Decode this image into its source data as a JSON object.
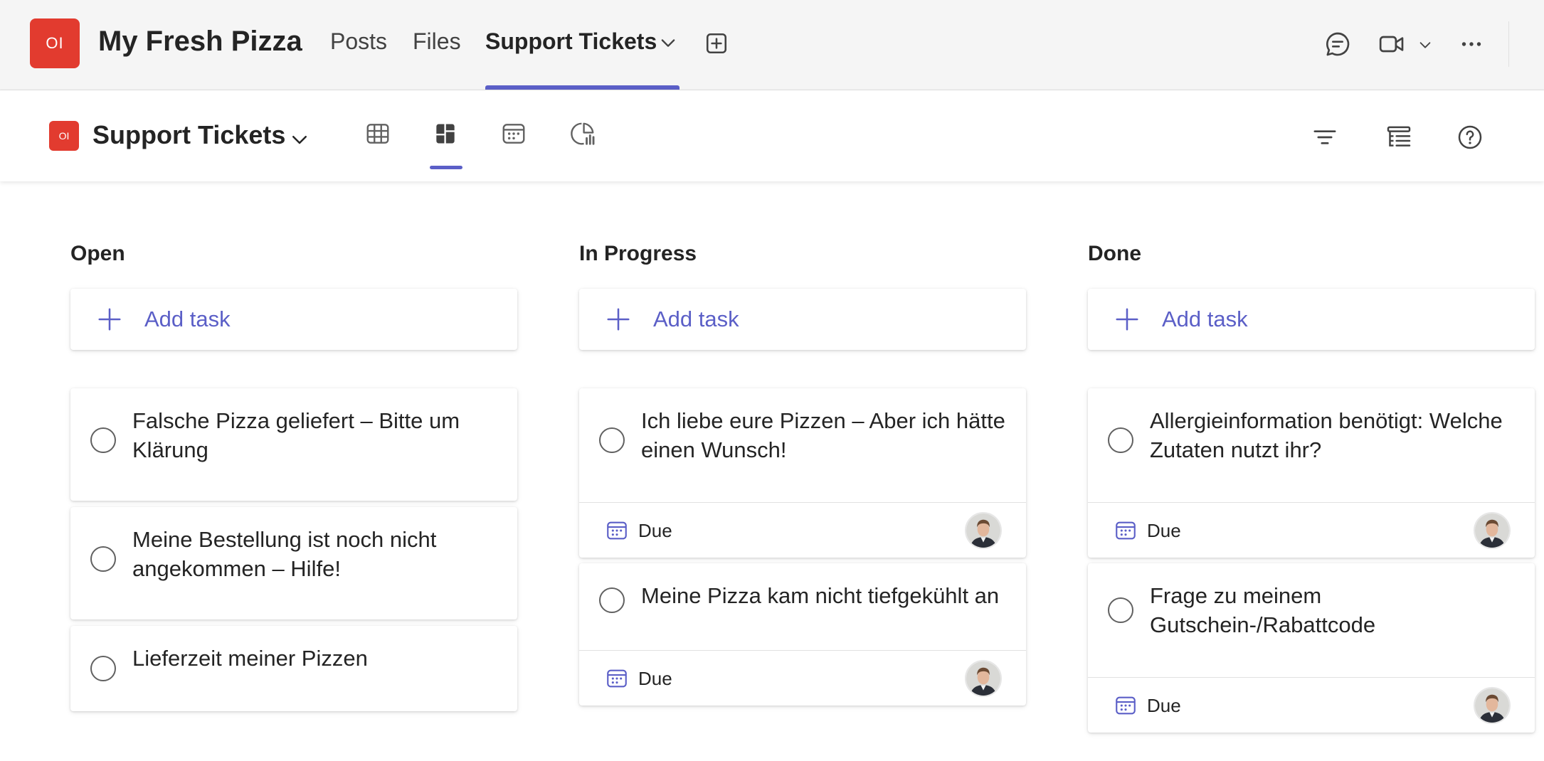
{
  "app": {
    "team_initials": "OI",
    "team_name": "My Fresh Pizza",
    "tabs": [
      {
        "label": "Posts"
      },
      {
        "label": "Files"
      },
      {
        "label": "Support Tickets"
      }
    ],
    "accent": "#5b5fc7",
    "brand_red": "#e23b2f"
  },
  "toolbar": {
    "plan_initials": "OI",
    "plan_name": "Support Tickets",
    "views": [
      "grid-icon",
      "board-icon",
      "schedule-icon",
      "charts-icon"
    ],
    "active_view": "board-icon",
    "tools": [
      "filter-icon",
      "group-by-icon",
      "help-icon"
    ]
  },
  "board": {
    "add_task_label": "Add task",
    "due_label": "Due",
    "buckets": [
      {
        "title": "Open",
        "tasks": [
          {
            "title": "Falsche Pizza geliefert – Bitte um Klärung"
          },
          {
            "title": "Meine Bestellung ist noch nicht angekommen – Hilfe!"
          },
          {
            "title": "Lieferzeit meiner Pizzen"
          }
        ]
      },
      {
        "title": "In Progress",
        "tasks": [
          {
            "title": "Ich liebe eure Pizzen – Aber ich hätte einen Wunsch!",
            "due": "Due"
          },
          {
            "title": "Meine Pizza kam nicht tiefgekühlt an",
            "due": "Due"
          }
        ]
      },
      {
        "title": "Done",
        "tasks": [
          {
            "title": "Allergieinformation benötigt: Welche Zutaten nutzt ihr?",
            "due": "Due"
          },
          {
            "title": "Frage zu meinem Gutschein-/Rabattcode",
            "due": "Due"
          }
        ]
      }
    ]
  }
}
